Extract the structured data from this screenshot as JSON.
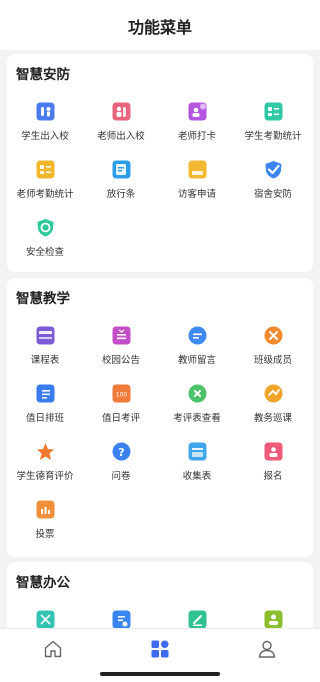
{
  "header": {
    "title": "功能菜单"
  },
  "sections": [
    {
      "title": "智慧安防",
      "items": [
        {
          "label": "学生出入校",
          "icon": "student-gate-icon",
          "color": "#4a7cf0"
        },
        {
          "label": "老师出入校",
          "icon": "teacher-gate-icon",
          "color": "#e8657c"
        },
        {
          "label": "老师打卡",
          "icon": "teacher-checkin-icon",
          "color": "#b455e0"
        },
        {
          "label": "学生考勤统计",
          "icon": "student-attendance-icon",
          "color": "#2fc7a6"
        },
        {
          "label": "老师考勤统计",
          "icon": "teacher-attendance-icon",
          "color": "#f2b62a"
        },
        {
          "label": "放行条",
          "icon": "pass-slip-icon",
          "color": "#2c9ee8"
        },
        {
          "label": "访客申请",
          "icon": "visitor-icon",
          "color": "#f4b731"
        },
        {
          "label": "宿舍安防",
          "icon": "dorm-security-icon",
          "color": "#3b86f2"
        },
        {
          "label": "安全检查",
          "icon": "safety-check-icon",
          "color": "#2ec99a"
        }
      ]
    },
    {
      "title": "智慧教学",
      "items": [
        {
          "label": "课程表",
          "icon": "schedule-icon",
          "color": "#7b5bd6"
        },
        {
          "label": "校园公告",
          "icon": "notice-icon",
          "color": "#c24fc8"
        },
        {
          "label": "教师留言",
          "icon": "message-icon",
          "color": "#3d8af2"
        },
        {
          "label": "班级成员",
          "icon": "class-members-icon",
          "color": "#f28a2e"
        },
        {
          "label": "值日排班",
          "icon": "duty-roster-icon",
          "color": "#3a7cf0"
        },
        {
          "label": "值日考评",
          "icon": "duty-review-icon",
          "color": "#f07a3a"
        },
        {
          "label": "考评表查看",
          "icon": "evaluation-icon",
          "color": "#4cc26a"
        },
        {
          "label": "教务巡课",
          "icon": "patrol-icon",
          "color": "#f2a52a"
        },
        {
          "label": "学生德育评价",
          "icon": "moral-eval-icon",
          "color": "#f07b2e"
        },
        {
          "label": "问卷",
          "icon": "questionnaire-icon",
          "color": "#3b82f0"
        },
        {
          "label": "收集表",
          "icon": "collection-icon",
          "color": "#3fa6ec"
        },
        {
          "label": "报名",
          "icon": "signup-icon",
          "color": "#ee5a77"
        },
        {
          "label": "投票",
          "icon": "vote-icon",
          "color": "#f28f3b"
        }
      ]
    },
    {
      "title": "智慧办公",
      "items": [
        {
          "label": "",
          "icon": "office-app-icon",
          "color": "#33c3b3"
        },
        {
          "label": "",
          "icon": "office-doc-icon",
          "color": "#3a86f0"
        },
        {
          "label": "",
          "icon": "office-edit-icon",
          "color": "#2fc28f"
        },
        {
          "label": "",
          "icon": "office-person-icon",
          "color": "#8bbf2e"
        }
      ]
    }
  ],
  "tabbar": {
    "tabs": [
      {
        "icon": "home-icon",
        "active": false
      },
      {
        "icon": "grid-menu-icon",
        "active": true
      },
      {
        "icon": "profile-icon",
        "active": false
      }
    ],
    "active_color": "#3d6cf0",
    "inactive_color": "#666666"
  }
}
